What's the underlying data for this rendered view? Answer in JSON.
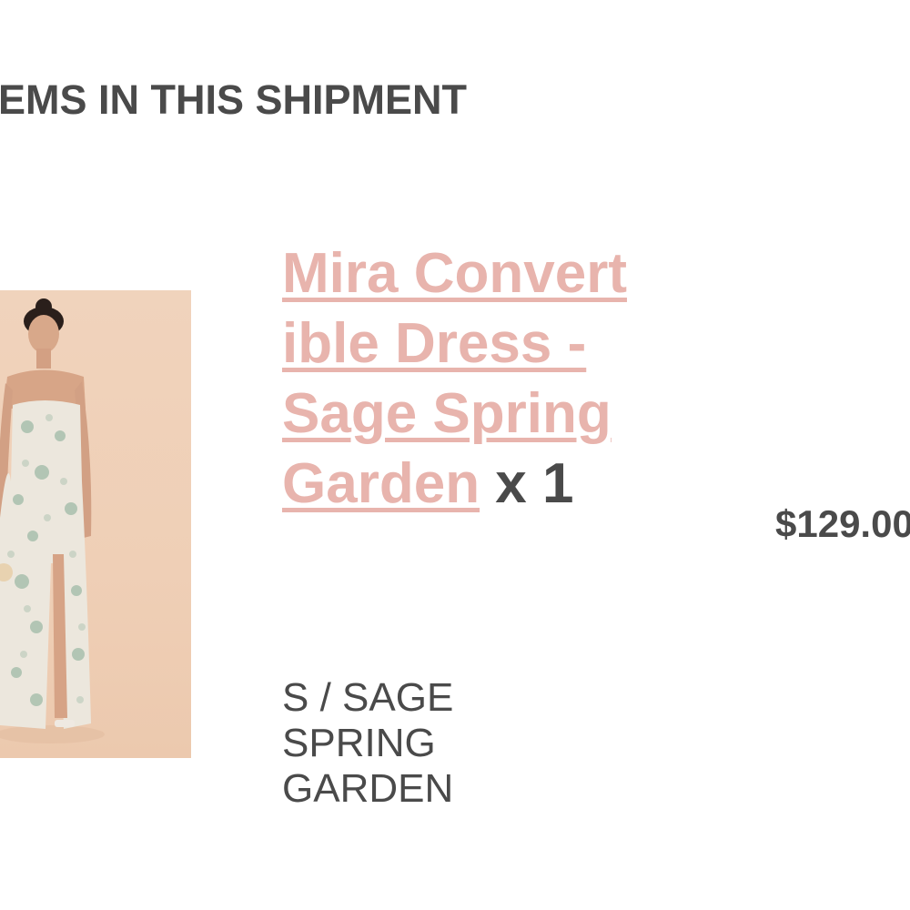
{
  "section": {
    "heading": "ITEMS IN THIS SHIPMENT"
  },
  "item": {
    "title": "Mira Convertible Dress - Sage Spring Garden",
    "quantity": "x 1",
    "variant": "S / SAGE SPRING GARDEN",
    "price": "$129.00",
    "image_description": "product-photo"
  },
  "colors": {
    "link": "#e8b4ad",
    "text": "#4a4a4a",
    "photo_background": "#efcfb6"
  }
}
